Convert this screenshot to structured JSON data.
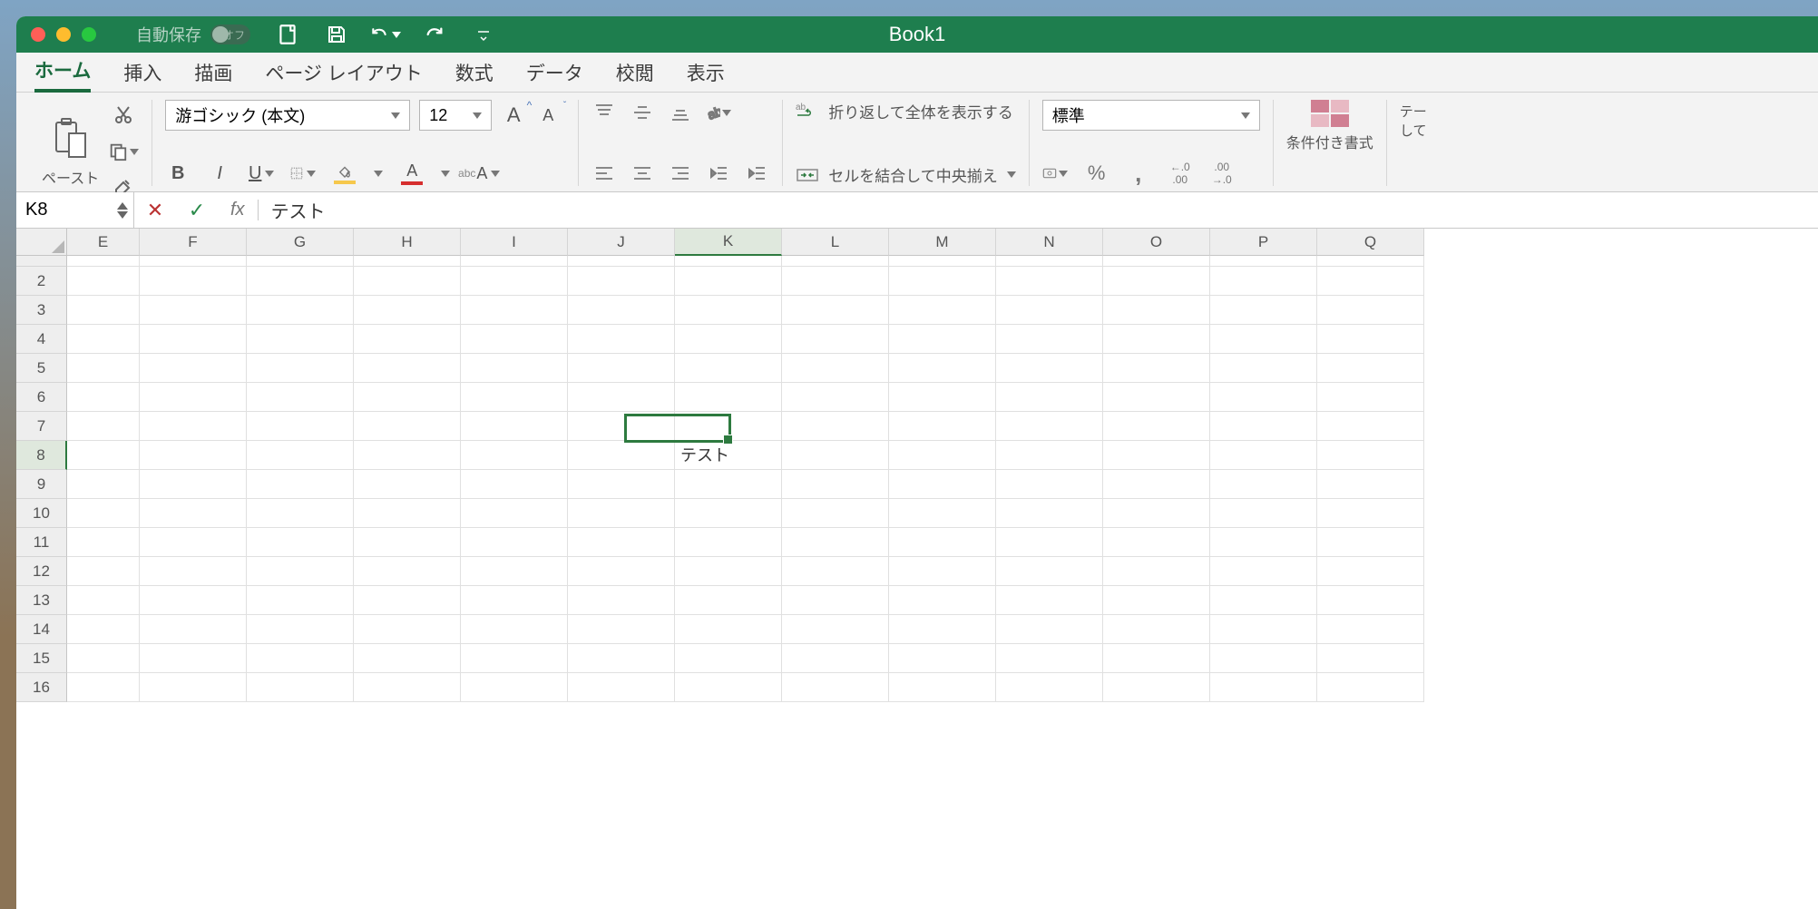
{
  "titlebar": {
    "autosave_label": "自動保存",
    "autosave_state": "オフ",
    "document_title": "Book1"
  },
  "tabs": [
    {
      "id": "home",
      "label": "ホーム",
      "active": true
    },
    {
      "id": "insert",
      "label": "挿入",
      "active": false
    },
    {
      "id": "draw",
      "label": "描画",
      "active": false
    },
    {
      "id": "pagelayout",
      "label": "ページ レイアウト",
      "active": false
    },
    {
      "id": "formulas",
      "label": "数式",
      "active": false
    },
    {
      "id": "data",
      "label": "データ",
      "active": false
    },
    {
      "id": "review",
      "label": "校閲",
      "active": false
    },
    {
      "id": "view",
      "label": "表示",
      "active": false
    }
  ],
  "ribbon": {
    "clipboard_label": "ペースト",
    "font_name": "游ゴシック (本文)",
    "font_size": "12",
    "wrap_text_label": "折り返して全体を表示する",
    "merge_center_label": "セルを結合して中央揃え",
    "number_format": "標準",
    "cond_format_label": "条件付き書式",
    "table_format_label": "テーブルとして"
  },
  "formula_bar": {
    "name_box": "K8",
    "fx_label": "fx",
    "formula_value": "テスト"
  },
  "grid": {
    "columns": [
      "E",
      "F",
      "G",
      "H",
      "I",
      "J",
      "K",
      "L",
      "M",
      "N",
      "O",
      "P",
      "Q"
    ],
    "active_column": "K",
    "rows": [
      "2",
      "3",
      "4",
      "5",
      "6",
      "7",
      "8",
      "9",
      "10",
      "11",
      "12",
      "13",
      "14",
      "15",
      "16"
    ],
    "active_row": "8",
    "active_cell_value": "テスト",
    "colors": {
      "accent": "#1e7e4e",
      "selection": "#2d7a3f"
    }
  }
}
